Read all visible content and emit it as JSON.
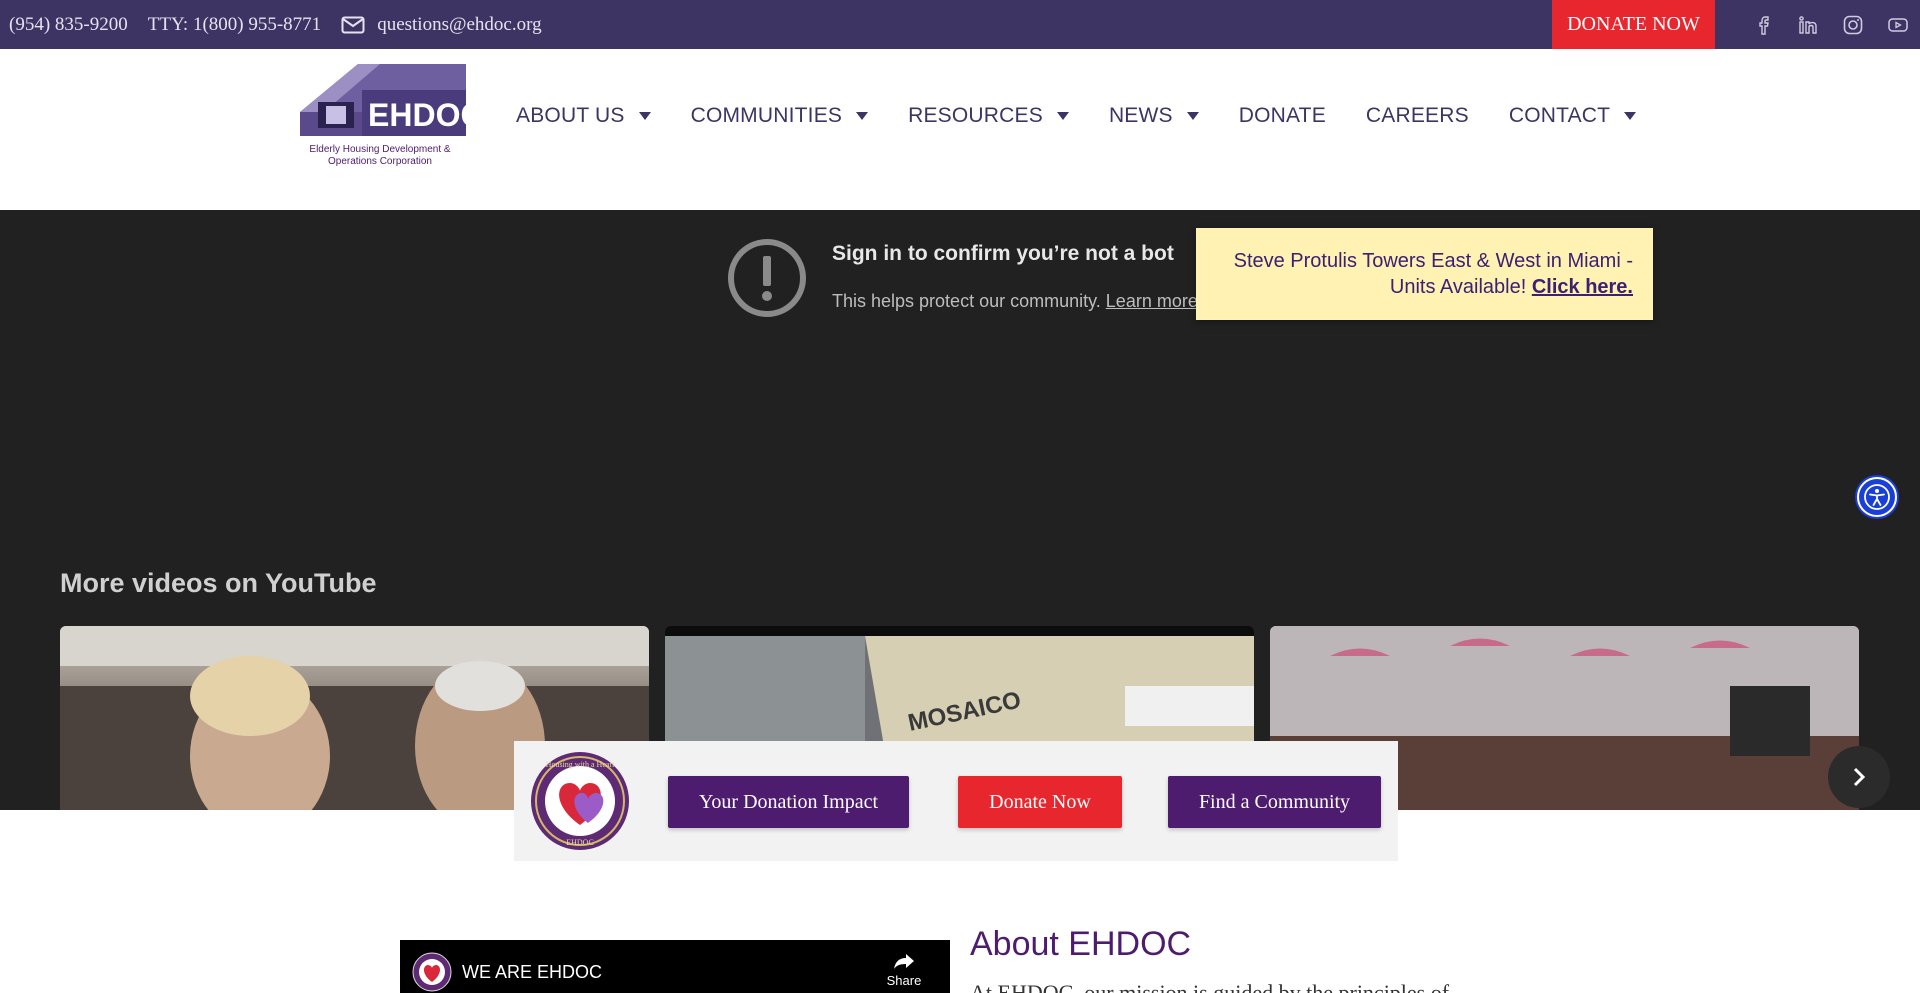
{
  "topbar": {
    "phone": "(954) 835-9200",
    "tty": "TTY: 1(800) 955-8771",
    "email": "questions@ehdoc.org",
    "donate_label": "DONATE NOW",
    "socials": [
      "facebook-icon",
      "linkedin-icon",
      "instagram-icon",
      "youtube-icon"
    ]
  },
  "logo": {
    "wordmark": "EHDOC",
    "tagline_1": "Elderly Housing Development &",
    "tagline_2": "Operations Corporation"
  },
  "nav": {
    "items": [
      {
        "label": "ABOUT US",
        "has_caret": true
      },
      {
        "label": "COMMUNITIES",
        "has_caret": true
      },
      {
        "label": "RESOURCES",
        "has_caret": true
      },
      {
        "label": "NEWS",
        "has_caret": true
      },
      {
        "label": "DONATE",
        "has_caret": false
      },
      {
        "label": "CAREERS",
        "has_caret": false
      },
      {
        "label": "CONTACT",
        "has_caret": true
      }
    ]
  },
  "video": {
    "bot_title": "Sign in to confirm you’re not a bot",
    "bot_sub": "This helps protect our community.",
    "learn_more": "Learn more",
    "more_videos": "More videos on YouTube",
    "thumb2_sign": "MOSAICO"
  },
  "notice": {
    "text": "Steve Protulis Towers East & West in Miami - Units Available!",
    "link": "Click here."
  },
  "cta": {
    "seal_text_top": "Housing with a Heart",
    "seal_text_bottom": "EHDOC",
    "impact": "Your Donation Impact",
    "donate": "Donate Now",
    "find": "Find a Community"
  },
  "embed": {
    "title": "WE ARE EHDOC",
    "share": "Share"
  },
  "about": {
    "title": "About EHDOC",
    "text": "At EHDOC, our mission is guided by the principles of"
  },
  "colors": {
    "topbar": "#3e3464",
    "accent_red": "#e8262d",
    "brand_purple": "#4e1c6e",
    "notice_bg": "#fff2b3"
  }
}
